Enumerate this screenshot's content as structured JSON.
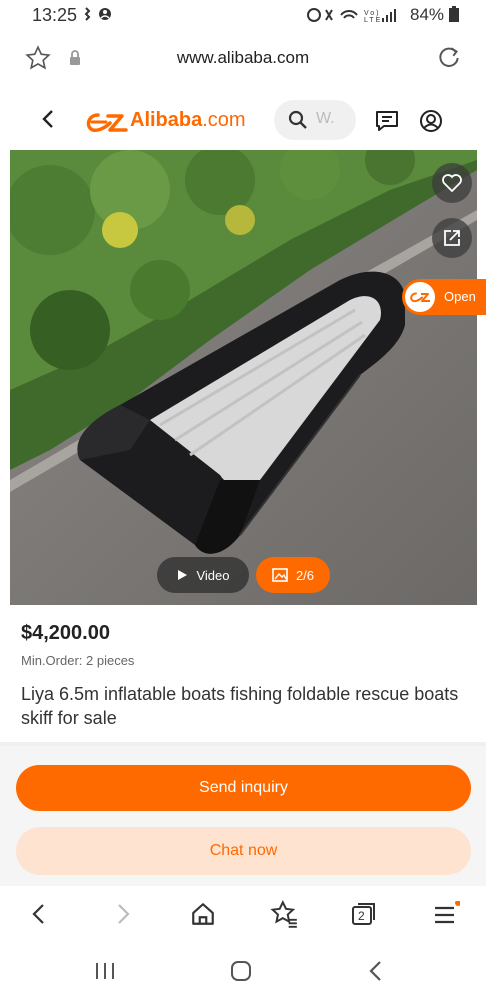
{
  "status_bar": {
    "time": "13:25",
    "battery": "84%"
  },
  "address_bar": {
    "url": "www.alibaba.com"
  },
  "header": {
    "logo_text": "Alibaba",
    "logo_suffix": ".com",
    "search_placeholder": "W."
  },
  "gallery": {
    "video_label": "Video",
    "counter": "2/6",
    "open_label": "Open"
  },
  "product": {
    "price": "$4,200.00",
    "min_order": "Min.Order: 2 pieces",
    "title": "Liya 6.5m inflatable boats fishing foldable rescue boats skiff for sale"
  },
  "actions": {
    "send_inquiry": "Send inquiry",
    "chat_now": "Chat now"
  },
  "browser_nav": {
    "tabs_count": "2"
  },
  "colors": {
    "accent": "#ff6a00",
    "chat_bg": "#ffe3d1"
  },
  "icons": [
    "star-icon",
    "lock-icon",
    "reload-icon",
    "back-icon",
    "search-icon",
    "message-icon",
    "account-icon",
    "heart-icon",
    "share-icon",
    "play-icon",
    "image-icon",
    "home-icon",
    "bookmarks-icon",
    "tabs-icon",
    "menu-icon"
  ]
}
